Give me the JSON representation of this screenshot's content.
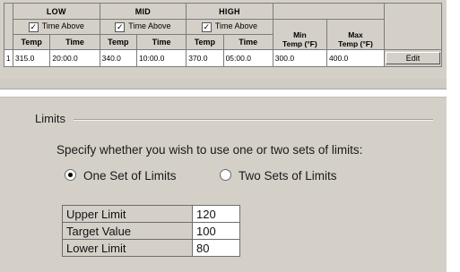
{
  "table": {
    "groups": [
      "LOW",
      "MID",
      "HIGH"
    ],
    "time_above_label": "Time Above",
    "time_above_checked": [
      true,
      true,
      true
    ],
    "checkmark": "✓",
    "sub_headers": {
      "temp": "Temp",
      "time": "Time"
    },
    "min_header": {
      "line1": "Min",
      "line2": "Temp (°F)"
    },
    "max_header": {
      "line1": "Max",
      "line2": "Temp (°F)"
    },
    "row": {
      "index": "1",
      "low_temp": "315.0",
      "low_time": "20:00.0",
      "mid_temp": "340.0",
      "mid_time": "10:00.0",
      "high_temp": "370.0",
      "high_time": "05:00.0",
      "min_temp": "300.0",
      "max_temp": "400.0",
      "edit_label": "Edit"
    }
  },
  "limits": {
    "legend": "Limits",
    "prompt": "Specify whether you wish to use one or two sets of limits:",
    "options": [
      {
        "label": "One Set of Limits",
        "selected": true
      },
      {
        "label": "Two Sets of Limits",
        "selected": false
      }
    ],
    "rows": [
      {
        "label": "Upper Limit",
        "value": "120"
      },
      {
        "label": "Target Value",
        "value": "100"
      },
      {
        "label": "Lower Limit",
        "value": "80"
      }
    ]
  }
}
